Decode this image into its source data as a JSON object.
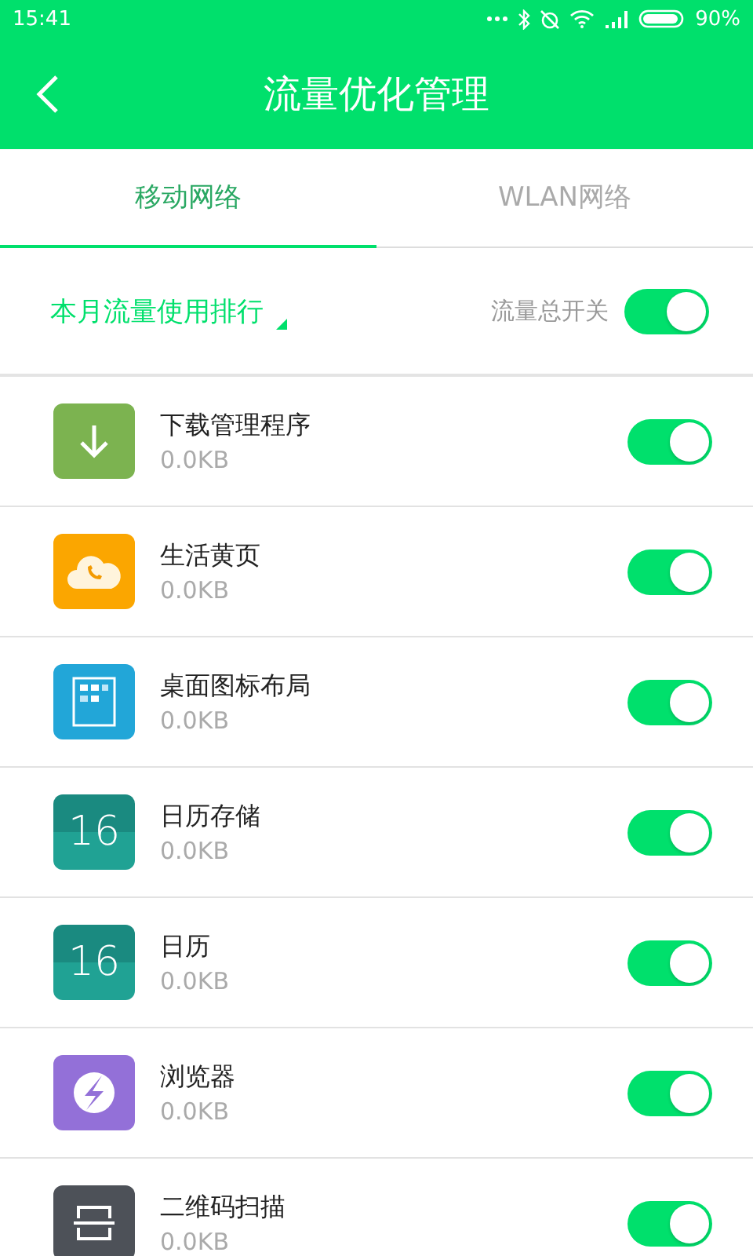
{
  "status_bar": {
    "time": "15:41",
    "battery": "90%"
  },
  "header": {
    "title": "流量优化管理"
  },
  "tabs": [
    {
      "label": "移动网络",
      "selected": true
    },
    {
      "label": "WLAN网络",
      "selected": false
    }
  ],
  "filter": {
    "sort_label": "本月流量使用排行",
    "master_switch_label": "流量总开关",
    "master_on": true
  },
  "apps": [
    {
      "name": "下载管理程序",
      "usage": "0.0KB",
      "kind": "download",
      "on": true
    },
    {
      "name": "生活黄页",
      "usage": "0.0KB",
      "kind": "yellowpages",
      "on": true
    },
    {
      "name": "桌面图标布局",
      "usage": "0.0KB",
      "kind": "layout",
      "on": true
    },
    {
      "name": "日历存储",
      "usage": "0.0KB",
      "kind": "calendar",
      "icon_label": "16",
      "on": true
    },
    {
      "name": "日历",
      "usage": "0.0KB",
      "kind": "calendar",
      "icon_label": "16",
      "on": true
    },
    {
      "name": "浏览器",
      "usage": "0.0KB",
      "kind": "browser",
      "on": true
    },
    {
      "name": "二维码扫描",
      "usage": "0.0KB",
      "kind": "scanner",
      "on": true
    }
  ]
}
